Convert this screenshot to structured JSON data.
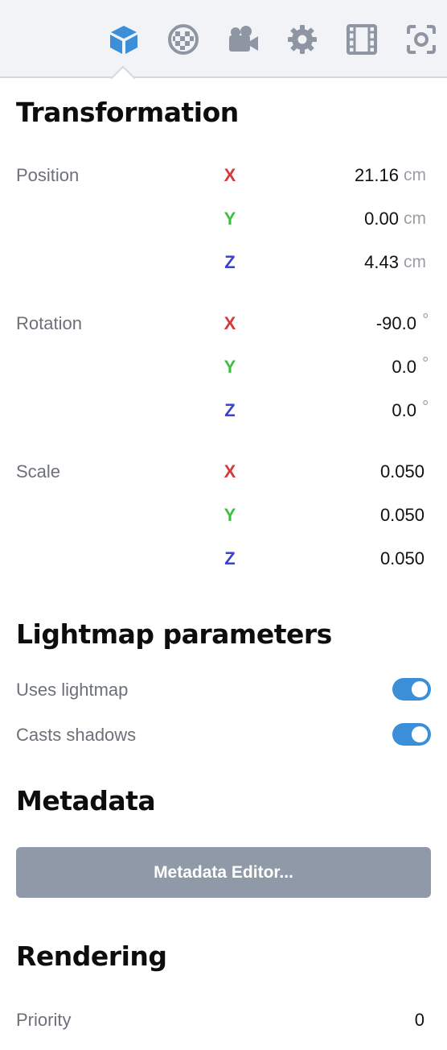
{
  "toolbar": {
    "tools": [
      {
        "icon": "cube-icon",
        "active": true
      },
      {
        "icon": "material-ball-icon",
        "active": false
      },
      {
        "icon": "camera-icon",
        "active": false
      },
      {
        "icon": "gear-icon",
        "active": false
      },
      {
        "icon": "film-strip-icon",
        "active": false
      },
      {
        "icon": "focus-frame-icon",
        "active": false
      }
    ],
    "active_color": "#3b8fd9",
    "inactive_color": "#8f96a3"
  },
  "transformation": {
    "title": "Transformation",
    "position": {
      "label": "Position",
      "x": {
        "axis": "X",
        "value": "21.16",
        "unit": "cm"
      },
      "y": {
        "axis": "Y",
        "value": "0.00",
        "unit": "cm"
      },
      "z": {
        "axis": "Z",
        "value": "4.43",
        "unit": "cm"
      }
    },
    "rotation": {
      "label": "Rotation",
      "x": {
        "axis": "X",
        "value": "-90.0",
        "unit": "°"
      },
      "y": {
        "axis": "Y",
        "value": "0.0",
        "unit": "°"
      },
      "z": {
        "axis": "Z",
        "value": "0.0",
        "unit": "°"
      }
    },
    "scale": {
      "label": "Scale",
      "x": {
        "axis": "X",
        "value": "0.050"
      },
      "y": {
        "axis": "Y",
        "value": "0.050"
      },
      "z": {
        "axis": "Z",
        "value": "0.050"
      }
    }
  },
  "lightmap": {
    "title": "Lightmap parameters",
    "uses_lightmap": {
      "label": "Uses lightmap",
      "on": true
    },
    "casts_shadows": {
      "label": "Casts shadows",
      "on": true
    }
  },
  "metadata": {
    "title": "Metadata",
    "editor_button": "Metadata Editor..."
  },
  "rendering": {
    "title": "Rendering",
    "priority": {
      "label": "Priority",
      "value": "0"
    }
  }
}
